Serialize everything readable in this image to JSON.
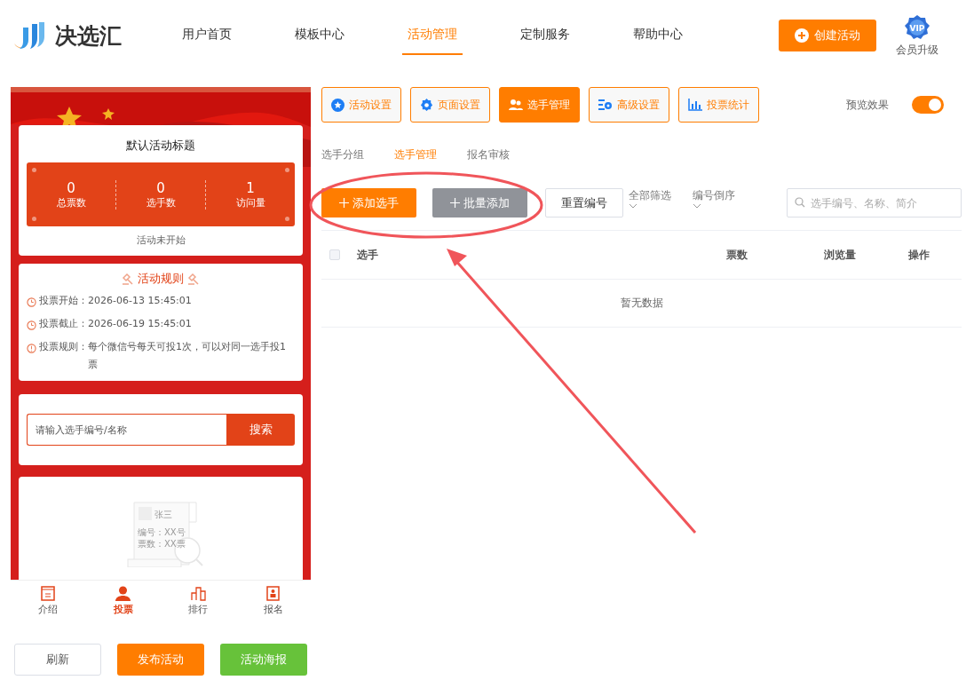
{
  "logo": {
    "text": "决选汇"
  },
  "nav": [
    {
      "label": "用户首页",
      "selected": false
    },
    {
      "label": "模板中心",
      "selected": false
    },
    {
      "label": "活动管理",
      "selected": true
    },
    {
      "label": "定制服务",
      "selected": false
    },
    {
      "label": "帮助中心",
      "selected": false
    }
  ],
  "create_button": "创建活动",
  "vip": {
    "badge": "VIP",
    "label": "会员升级"
  },
  "preview": {
    "title": "默认活动标题",
    "stats": [
      {
        "value": "0",
        "label": "总票数"
      },
      {
        "value": "0",
        "label": "选手数"
      },
      {
        "value": "1",
        "label": "访问量"
      }
    ],
    "status": "活动未开始",
    "rules": {
      "title": "活动规则",
      "items": [
        {
          "kind": "clock",
          "label": "投票开始：",
          "value": "2026-06-13 15:45:01"
        },
        {
          "kind": "clock",
          "label": "投票截止：",
          "value": "2026-06-19 15:45:01"
        },
        {
          "kind": "alert",
          "label": "投票规则：",
          "value": "每个微信号每天可投1次，可以对同一选手投1票"
        }
      ]
    },
    "search": {
      "placeholder": "请输入选手编号/名称",
      "button": "搜索"
    },
    "empty_card": {
      "name": "张三",
      "lines": [
        "编号：XX号",
        "票数：XX票"
      ]
    },
    "bottom_nav": [
      {
        "label": "介绍",
        "kind": "intro",
        "selected": false
      },
      {
        "label": "投票",
        "kind": "vote",
        "selected": true
      },
      {
        "label": "排行",
        "kind": "rank",
        "selected": false
      },
      {
        "label": "报名",
        "kind": "signup",
        "selected": false
      }
    ]
  },
  "actions": [
    {
      "label": "刷新",
      "kind": "outline"
    },
    {
      "label": "发布活动",
      "kind": "orange"
    },
    {
      "label": "活动海报",
      "kind": "green"
    }
  ],
  "toolbar": [
    {
      "label": "活动设置",
      "kind": "star",
      "selected": false
    },
    {
      "label": "页面设置",
      "kind": "gear",
      "selected": false
    },
    {
      "label": "选手管理",
      "kind": "users",
      "selected": true
    },
    {
      "label": "高级设置",
      "kind": "sliders",
      "selected": false
    },
    {
      "label": "投票统计",
      "kind": "chart",
      "selected": false
    }
  ],
  "preview_toggle": {
    "label": "预览效果",
    "on": true
  },
  "subtabs": [
    {
      "label": "选手分组",
      "selected": false
    },
    {
      "label": "选手管理",
      "selected": true
    },
    {
      "label": "报名审核",
      "selected": false
    }
  ],
  "buttons": [
    {
      "label": "添加选手",
      "kind": "primary"
    },
    {
      "label": "批量添加",
      "kind": "secondary"
    },
    {
      "label": "重置编号",
      "kind": "outline"
    }
  ],
  "filters": [
    {
      "label": "全部筛选"
    },
    {
      "label": "编号倒序"
    }
  ],
  "list_search": {
    "placeholder": "选手编号、名称、简介"
  },
  "table": {
    "select_all": false,
    "columns": [
      "选手",
      "票数",
      "浏览量",
      "操作"
    ],
    "empty": "暂无数据"
  }
}
